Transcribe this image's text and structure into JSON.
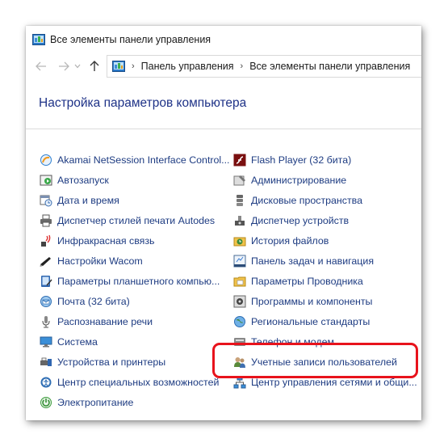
{
  "window": {
    "title": "Все элементы панели управления"
  },
  "address": {
    "breadcrumbs": [
      "Панель управления",
      "Все элементы панели управления"
    ]
  },
  "heading": "Настройка параметров компьютера",
  "left_items": [
    {
      "label": "Akamai NetSession Interface Control...",
      "icon": "akamai-icon"
    },
    {
      "label": "Автозапуск",
      "icon": "autoplay-icon"
    },
    {
      "label": "Дата и время",
      "icon": "calendar-clock-icon"
    },
    {
      "label": "Диспетчер стилей печати Autodes",
      "icon": "printer-icon"
    },
    {
      "label": "Инфракрасная связь",
      "icon": "infrared-icon"
    },
    {
      "label": "Настройки Wacom",
      "icon": "wacom-pen-icon"
    },
    {
      "label": "Параметры планшетного компью...",
      "icon": "tablet-icon"
    },
    {
      "label": "Почта (32 бита)",
      "icon": "mail-icon"
    },
    {
      "label": "Распознавание речи",
      "icon": "microphone-icon"
    },
    {
      "label": "Система",
      "icon": "monitor-icon"
    },
    {
      "label": "Устройства и принтеры",
      "icon": "devices-printers-icon"
    },
    {
      "label": "Центр специальных возможностей",
      "icon": "accessibility-icon"
    },
    {
      "label": "Электропитание",
      "icon": "power-icon"
    }
  ],
  "right_items": [
    {
      "label": "Flash Player (32 бита)",
      "icon": "flash-icon"
    },
    {
      "label": "Администрирование",
      "icon": "admin-tools-icon"
    },
    {
      "label": "Дисковые пространства",
      "icon": "storage-spaces-icon"
    },
    {
      "label": "Диспетчер устройств",
      "icon": "device-manager-icon"
    },
    {
      "label": "История файлов",
      "icon": "file-history-icon"
    },
    {
      "label": "Панель задач и навигация",
      "icon": "taskbar-icon"
    },
    {
      "label": "Параметры Проводника",
      "icon": "folder-options-icon"
    },
    {
      "label": "Программы и компоненты",
      "icon": "programs-icon"
    },
    {
      "label": "Региональные стандарты",
      "icon": "region-icon"
    },
    {
      "label": "Телефон и модем",
      "icon": "phone-modem-icon"
    },
    {
      "label": "Учетные записи пользователей",
      "icon": "user-accounts-icon"
    },
    {
      "label": "Центр управления сетями и общи...",
      "icon": "network-center-icon"
    }
  ],
  "colors": {
    "link": "#1e3c82",
    "heading": "#1e3287",
    "highlight": "#e8131c"
  }
}
